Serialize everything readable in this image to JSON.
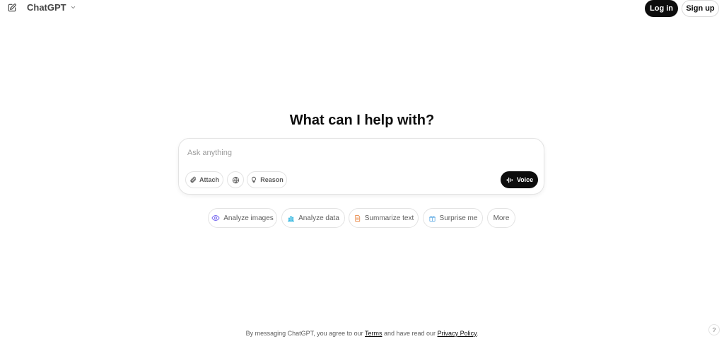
{
  "header": {
    "edit_icon": "new-chat-icon",
    "brand_label": "ChatGPT",
    "chevron_icon": "chevron-down-icon",
    "login_label": "Log in",
    "signup_label": "Sign up"
  },
  "main": {
    "headline": "What can I help with?",
    "composer": {
      "placeholder": "Ask anything",
      "attach_label": "Attach",
      "search_icon": "globe-icon",
      "reason_label": "Reason",
      "voice_label": "Voice"
    },
    "suggestions": [
      {
        "label": "Analyze images",
        "icon": "eye-icon",
        "color": "#7c6ef0"
      },
      {
        "label": "Analyze data",
        "icon": "bar-chart-icon",
        "color": "#35b7e0"
      },
      {
        "label": "Summarize text",
        "icon": "document-icon",
        "color": "#e98a4a"
      },
      {
        "label": "Surprise me",
        "icon": "gift-icon",
        "color": "#76b6e8"
      },
      {
        "label": "More"
      }
    ]
  },
  "footer": {
    "prefix": "By messaging ChatGPT, you agree to our ",
    "terms_label": "Terms",
    "middle": " and have read our ",
    "privacy_label": "Privacy Policy",
    "suffix": ".",
    "help_label": "?"
  }
}
